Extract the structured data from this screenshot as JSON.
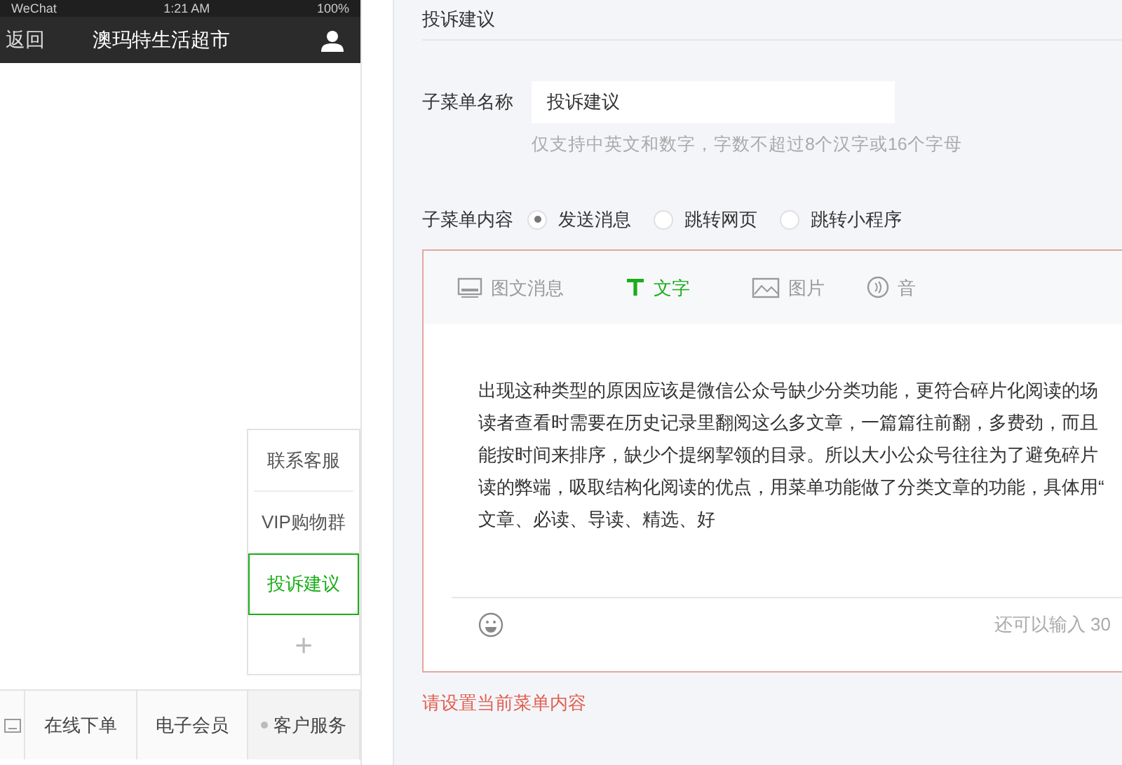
{
  "phone": {
    "status_bar": {
      "carrier": "WeChat",
      "time": "1:21 AM",
      "battery": "100%"
    },
    "back": "返回",
    "title": "澳玛特生活超市",
    "submenu": [
      {
        "label": "联系客服",
        "selected": false
      },
      {
        "label": "VIP购物群",
        "selected": false
      },
      {
        "label": "投诉建议",
        "selected": true
      }
    ],
    "add_symbol": "+",
    "menu": [
      {
        "label": "在线下单",
        "selected": false
      },
      {
        "label": "电子会员",
        "selected": false
      },
      {
        "label": "客户服务",
        "selected": true
      }
    ]
  },
  "editor_panel": {
    "title": "投诉建议",
    "name_label": "子菜单名称",
    "name_value": "投诉建议",
    "name_hint": "仅支持中英文和数字，字数不超过8个汉字或16个字母",
    "content_label": "子菜单内容",
    "content_options": [
      {
        "label": "发送消息",
        "selected": true
      },
      {
        "label": "跳转网页",
        "selected": false
      },
      {
        "label": "跳转小程序",
        "selected": false
      }
    ],
    "message_tabs": [
      {
        "kind": "news",
        "label": "图文消息",
        "selected": false
      },
      {
        "kind": "text",
        "label": "文字",
        "selected": true
      },
      {
        "kind": "image",
        "label": "图片",
        "selected": false
      },
      {
        "kind": "audio",
        "label": "音",
        "selected": false
      }
    ],
    "message_lines": [
      "出现这种类型的原因应该是微信公众号缺少分类功能，更符合碎片化阅读的场",
      "读者查看时需要在历史记录里翻阅这么多文章，一篇篇往前翻，多费劲，而且",
      "能按时间来排序，缺少个提纲挈领的目录。所以大小公众号往往为了避免碎片",
      "读的弊端，吸取结构化阅读的优点，用菜单功能做了分类文章的功能，具体用“",
      "文章、必读、导读、精选、好"
    ],
    "counter": "还可以输入 30",
    "error": "请设置当前菜单内容"
  }
}
